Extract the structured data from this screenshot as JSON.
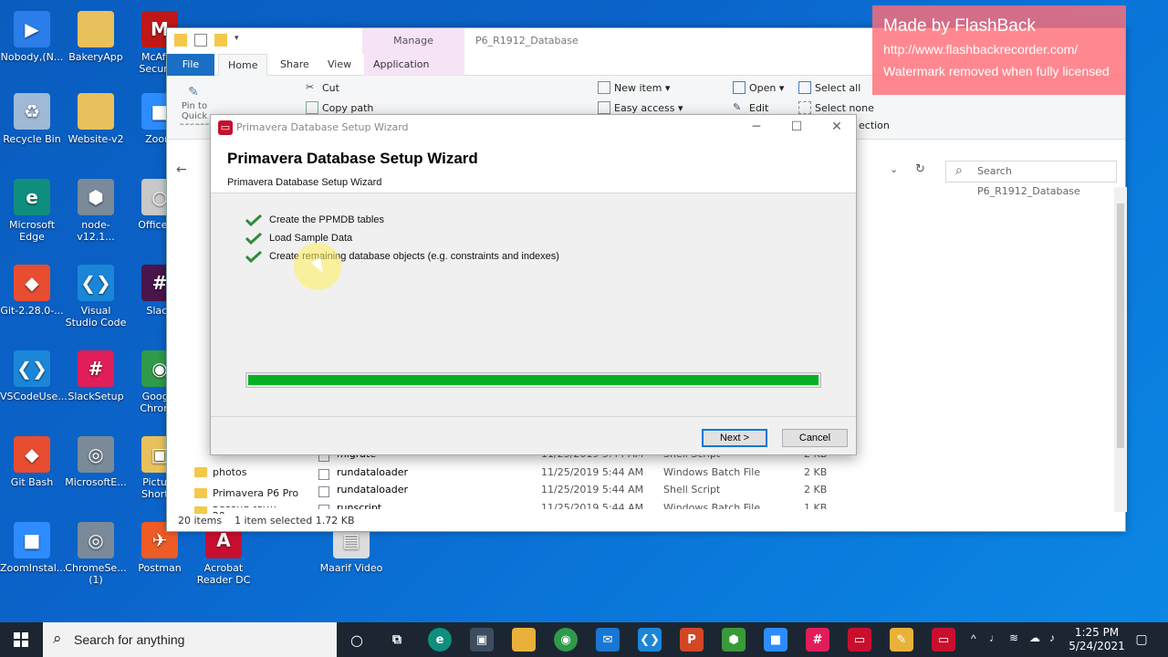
{
  "desktop": {
    "icons": [
      {
        "label": "Nobody,(N...",
        "color": "#2b7de9",
        "glyph": "▶"
      },
      {
        "label": "BakeryApp",
        "color": "#e8c15c",
        "glyph": ""
      },
      {
        "label": "McAfee Security",
        "color": "#c01818",
        "glyph": "M"
      },
      {
        "label": "Recycle Bin",
        "color": "#9fb9d6",
        "glyph": "♻"
      },
      {
        "label": "Website-v2",
        "color": "#e8c15c",
        "glyph": ""
      },
      {
        "label": "Zoom",
        "color": "#2d8cff",
        "glyph": "■"
      },
      {
        "label": "Microsoft Edge",
        "color": "#0f8e7e",
        "glyph": "e"
      },
      {
        "label": "node-v12.1...",
        "color": "#7a8a99",
        "glyph": "⬢"
      },
      {
        "label": "OfficeP...",
        "color": "#c8c8c8",
        "glyph": "○"
      },
      {
        "label": "Git-2.28.0-...",
        "color": "#e84d31",
        "glyph": "◆"
      },
      {
        "label": "Visual Studio Code",
        "color": "#1b86d8",
        "glyph": "❮❯"
      },
      {
        "label": "Slack",
        "color": "#4a154b",
        "glyph": "#"
      },
      {
        "label": "VSCodeUse...",
        "color": "#1b86d8",
        "glyph": "❮❯"
      },
      {
        "label": "SlackSetup",
        "color": "#e01e5a",
        "glyph": "#"
      },
      {
        "label": "Google Chrome",
        "color": "#2f9a4a",
        "glyph": "◉"
      },
      {
        "label": "Git Bash",
        "color": "#e84d31",
        "glyph": "◆"
      },
      {
        "label": "MicrosoftE...",
        "color": "#7a8a99",
        "glyph": "◎"
      },
      {
        "label": "Picture Short...",
        "color": "#e8c15c",
        "glyph": "▣"
      },
      {
        "label": "ZoomInstal...",
        "color": "#2d8cff",
        "glyph": "■"
      },
      {
        "label": "ChromeSe... (1)",
        "color": "#7a8a99",
        "glyph": "◎"
      },
      {
        "label": "Postman",
        "color": "#ef5b25",
        "glyph": "✈"
      },
      {
        "label": "Acrobat Reader DC",
        "color": "#c8102e",
        "glyph": "A"
      },
      {
        "label": "Maarif Video",
        "color": "#dcdcdc",
        "glyph": "▤"
      }
    ]
  },
  "explorer": {
    "title": "P6_R1912_Database",
    "manage_tab": "Manage",
    "tabs": {
      "file": "File",
      "home": "Home",
      "share": "Share",
      "view": "View",
      "app_tools": "Application Tools"
    },
    "ribbon": {
      "pin": "Pin to Quick access",
      "cut": "Cut",
      "copy_path": "Copy path",
      "new_item": "New item ▾",
      "easy_access": "Easy access ▾",
      "open": "Open ▾",
      "edit": "Edit",
      "select_all": "Select all",
      "select_none": "Select none",
      "invert_selection": "ection"
    },
    "search_placeholder": "Search P6_R1912_Database",
    "nav": [
      "photos",
      "Primavera P6 Pro",
      "Second term 20..."
    ],
    "files": [
      {
        "name": "migrate",
        "date": "11/25/2019 5:44 AM",
        "type": "Shell Script",
        "size": "2 KB"
      },
      {
        "name": "rundataloader",
        "date": "11/25/2019 5:44 AM",
        "type": "Windows Batch File",
        "size": "2 KB"
      },
      {
        "name": "rundataloader",
        "date": "11/25/2019 5:44 AM",
        "type": "Shell Script",
        "size": "2 KB"
      },
      {
        "name": "runscript",
        "date": "11/25/2019 5:44 AM",
        "type": "Windows Batch File",
        "size": "1 KB"
      }
    ],
    "status": {
      "items": "20 items",
      "selected": "1 item selected  1.72 KB"
    }
  },
  "wizard": {
    "window_title": "Primavera Database Setup Wizard",
    "heading": "Primavera Database Setup Wizard",
    "subheading": "Primavera Database Setup Wizard",
    "steps": [
      "Create the PPMDB tables",
      "Load Sample Data",
      "Create remaining database objects (e.g. constraints and indexes)"
    ],
    "progress_percent": 100,
    "progress_color": "#06b025",
    "next_label": "Next >",
    "cancel_label": "Cancel"
  },
  "watermark": {
    "line1": "Made by FlashBack",
    "line2": "http://www.flashbackrecorder.com/",
    "line3": "Watermark removed when fully licensed"
  },
  "taskbar": {
    "search_placeholder": "Search for anything",
    "time": "1:25 PM",
    "date": "5/24/2021"
  }
}
